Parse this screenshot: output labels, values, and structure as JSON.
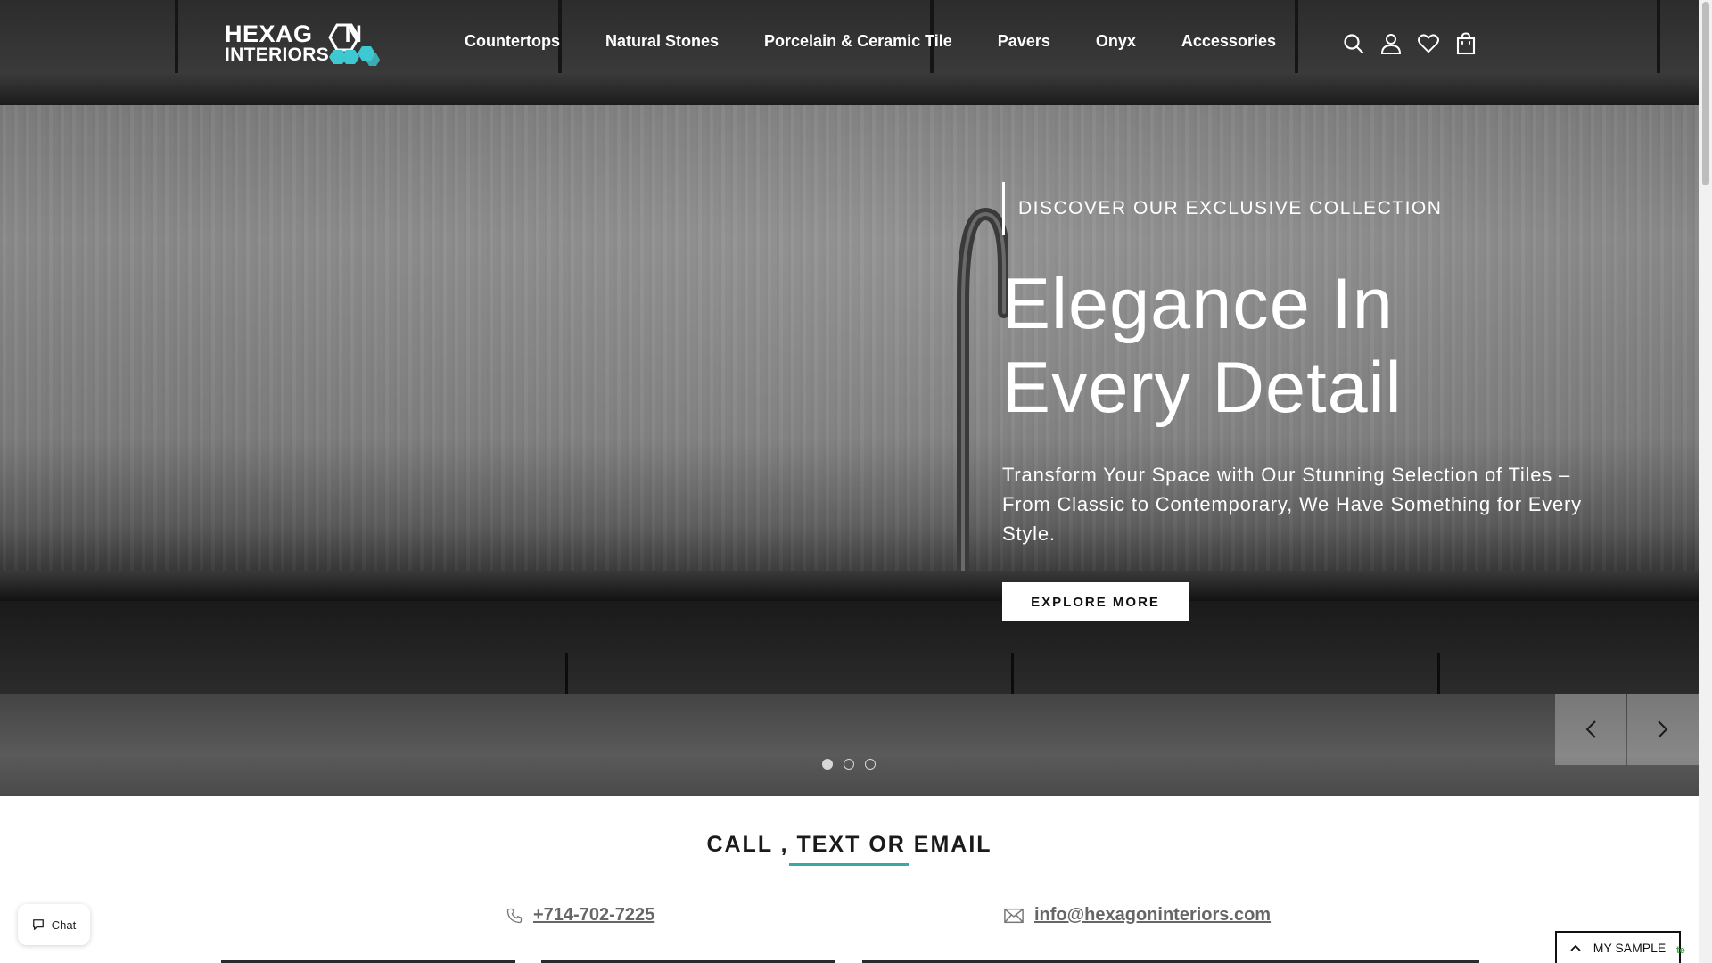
{
  "brand": {
    "logo_line1": "HEXAG",
    "logo_line1_end": "N",
    "logo_line2": "INTERIORS",
    "accent_color": "#3aa8a4",
    "logo_accent_color": "#3ec8d2"
  },
  "nav": {
    "items": [
      {
        "label": "Countertops"
      },
      {
        "label": "Natural Stones"
      },
      {
        "label": "Porcelain & Ceramic Tile"
      },
      {
        "label": "Pavers"
      },
      {
        "label": "Onyx"
      },
      {
        "label": "Accessories"
      }
    ]
  },
  "header_icons": [
    "search-icon",
    "account-icon",
    "wishlist-heart-icon",
    "cart-bag-icon"
  ],
  "hero": {
    "eyebrow": "DISCOVER OUR EXCLUSIVE COLLECTION",
    "headline": "Elegance In Every Detail",
    "subhead": "Transform Your Space with Our Stunning Selection of Tiles – From Classic to Contemporary, We Have Something for Every Style.",
    "cta_label": "EXPLORE MORE",
    "slide_count": 3,
    "active_slide": 1
  },
  "contact": {
    "title": "CALL , TEXT OR EMAIL",
    "phone": "+714-702-7225",
    "email": "info@hexagoninteriors.com"
  },
  "widgets": {
    "chat_label": "Chat",
    "sample_label": "MY SAMPLE",
    "recaptcha_fragment": "te"
  }
}
